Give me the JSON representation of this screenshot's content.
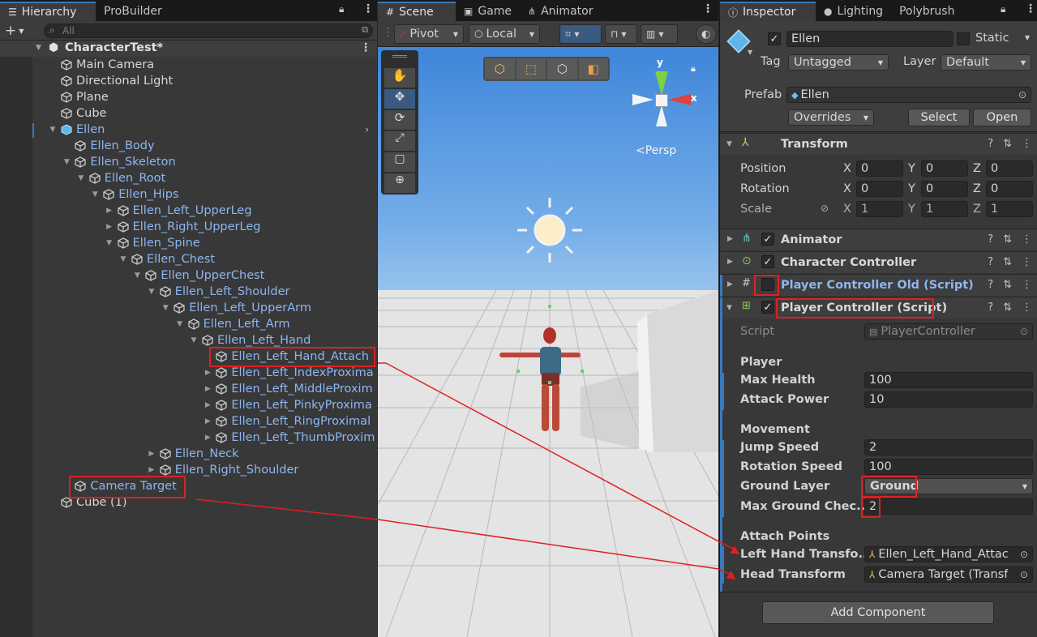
{
  "hierarchy": {
    "tabs": [
      "Hierarchy",
      "ProBuilder"
    ],
    "search_placeholder": "All",
    "scene_name": "CharacterTest*",
    "rows": [
      {
        "label": "Main Camera",
        "depth": 0,
        "kind": "plain",
        "arrow": ""
      },
      {
        "label": "Directional Light",
        "depth": 0,
        "kind": "plain",
        "arrow": ""
      },
      {
        "label": "Plane",
        "depth": 0,
        "kind": "plain",
        "arrow": ""
      },
      {
        "label": "Cube",
        "depth": 0,
        "kind": "plain",
        "arrow": ""
      },
      {
        "label": "Ellen",
        "depth": 0,
        "kind": "prefab",
        "arrow": "down"
      },
      {
        "label": "Ellen_Body",
        "depth": 1,
        "kind": "prefab",
        "arrow": ""
      },
      {
        "label": "Ellen_Skeleton",
        "depth": 1,
        "kind": "prefab",
        "arrow": "down"
      },
      {
        "label": "Ellen_Root",
        "depth": 2,
        "kind": "prefab",
        "arrow": "down"
      },
      {
        "label": "Ellen_Hips",
        "depth": 3,
        "kind": "prefab",
        "arrow": "down"
      },
      {
        "label": "Ellen_Left_UpperLeg",
        "depth": 4,
        "kind": "prefab",
        "arrow": "right"
      },
      {
        "label": "Ellen_Right_UpperLeg",
        "depth": 4,
        "kind": "prefab",
        "arrow": "right"
      },
      {
        "label": "Ellen_Spine",
        "depth": 4,
        "kind": "prefab",
        "arrow": "down"
      },
      {
        "label": "Ellen_Chest",
        "depth": 5,
        "kind": "prefab",
        "arrow": "down"
      },
      {
        "label": "Ellen_UpperChest",
        "depth": 6,
        "kind": "prefab",
        "arrow": "down"
      },
      {
        "label": "Ellen_Left_Shoulder",
        "depth": 7,
        "kind": "prefab",
        "arrow": "down"
      },
      {
        "label": "Ellen_Left_UpperArm",
        "depth": 8,
        "kind": "prefab",
        "arrow": "down"
      },
      {
        "label": "Ellen_Left_Arm",
        "depth": 9,
        "kind": "prefab",
        "arrow": "down"
      },
      {
        "label": "Ellen_Left_Hand",
        "depth": 10,
        "kind": "prefab",
        "arrow": "down"
      },
      {
        "label": "Ellen_Left_Hand_Attach",
        "depth": 11,
        "kind": "prefab",
        "arrow": ""
      },
      {
        "label": "Ellen_Left_IndexProxima",
        "depth": 11,
        "kind": "prefab",
        "arrow": "right"
      },
      {
        "label": "Ellen_Left_MiddleProxim",
        "depth": 11,
        "kind": "prefab",
        "arrow": "right"
      },
      {
        "label": "Ellen_Left_PinkyProxima",
        "depth": 11,
        "kind": "prefab",
        "arrow": "right"
      },
      {
        "label": "Ellen_Left_RingProximal",
        "depth": 11,
        "kind": "prefab",
        "arrow": "right"
      },
      {
        "label": "Ellen_Left_ThumbProxim",
        "depth": 11,
        "kind": "prefab",
        "arrow": "right"
      },
      {
        "label": "Ellen_Neck",
        "depth": 7,
        "kind": "prefab",
        "arrow": "right"
      },
      {
        "label": "Ellen_Right_Shoulder",
        "depth": 7,
        "kind": "prefab",
        "arrow": "right"
      },
      {
        "label": "Camera Target",
        "depth": 1,
        "kind": "prefab",
        "arrow": ""
      },
      {
        "label": "Cube (1)",
        "depth": 0,
        "kind": "plain",
        "arrow": ""
      }
    ]
  },
  "scene": {
    "tabs": [
      "Scene",
      "Game",
      "Animator"
    ],
    "pivot": "Pivot",
    "local": "Local",
    "persp": "<Persp",
    "gizmo_y": "y",
    "gizmo_x": "x"
  },
  "inspector": {
    "tabs": [
      "Inspector",
      "Lighting",
      "Polybrush"
    ],
    "object_name": "Ellen",
    "static_label": "Static",
    "tag_label": "Tag",
    "tag_value": "Untagged",
    "layer_label": "Layer",
    "layer_value": "Default",
    "prefab_label": "Prefab",
    "prefab_value": "Ellen",
    "overrides": "Overrides",
    "select": "Select",
    "open": "Open",
    "transform": {
      "title": "Transform",
      "position_label": "Position",
      "rotation_label": "Rotation",
      "scale_label": "Scale",
      "position": {
        "x": "0",
        "y": "0",
        "z": "0"
      },
      "rotation": {
        "x": "0",
        "y": "0",
        "z": "0"
      },
      "scale": {
        "x": "1",
        "y": "1",
        "z": "1"
      }
    },
    "animator_title": "Animator",
    "character_controller_title": "Character Controller",
    "player_controller_old_title": "Player Controller Old (Script)",
    "player_controller_title": "Player Controller (Script)",
    "script_label": "Script",
    "script_value": "PlayerController",
    "player_section": "Player",
    "max_health_label": "Max Health",
    "max_health": "100",
    "attack_power_label": "Attack Power",
    "attack_power": "10",
    "movement_section": "Movement",
    "jump_speed_label": "Jump Speed",
    "jump_speed": "2",
    "rotation_speed_label": "Rotation Speed",
    "rotation_speed": "100",
    "ground_layer_label": "Ground Layer",
    "ground_layer": "Ground",
    "max_ground_label": "Max Ground Chec...",
    "max_ground": "2",
    "attach_section": "Attach Points",
    "left_hand_label": "Left Hand Transfo...",
    "left_hand_value": "Ellen_Left_Hand_Attac",
    "head_label": "Head Transform",
    "head_value": "Camera Target (Transf",
    "add_component": "Add Component"
  },
  "colors": {
    "accent": "#3a79bb",
    "annotation": "#e02020",
    "prefab_text": "#8cb6f2"
  }
}
